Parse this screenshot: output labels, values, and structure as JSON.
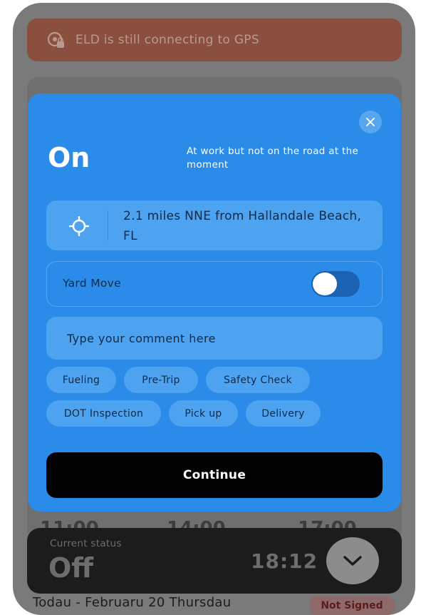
{
  "banner": {
    "text": "ELD is still connecting to GPS",
    "icon": "location-warning-icon"
  },
  "background": {
    "times": [
      "11:00",
      "14:00",
      "17:00"
    ]
  },
  "modal": {
    "status_title": "On",
    "status_description": "At work but not on the road at the moment",
    "location": "2.1 miles NNE from Hallandale Beach, FL",
    "yard_move_label": "Yard Move",
    "yard_move_enabled": false,
    "comment_placeholder": "Type your comment here",
    "chips": [
      "Fueling",
      "Pre-Trip",
      "Safety Check",
      "DOT Inspection",
      "Pick up",
      "Delivery"
    ],
    "continue_label": "Continue"
  },
  "status_bar": {
    "label": "Current status",
    "value": "Off",
    "time": "18:12"
  },
  "footer": {
    "day_text": "Todau - Februaru 20 Thursdau",
    "signed_badge": "Not Signed"
  },
  "colors": {
    "modal_bg": "#2a8be8",
    "button_bg": "#000000",
    "banner_bg": "#8a4f3f"
  }
}
